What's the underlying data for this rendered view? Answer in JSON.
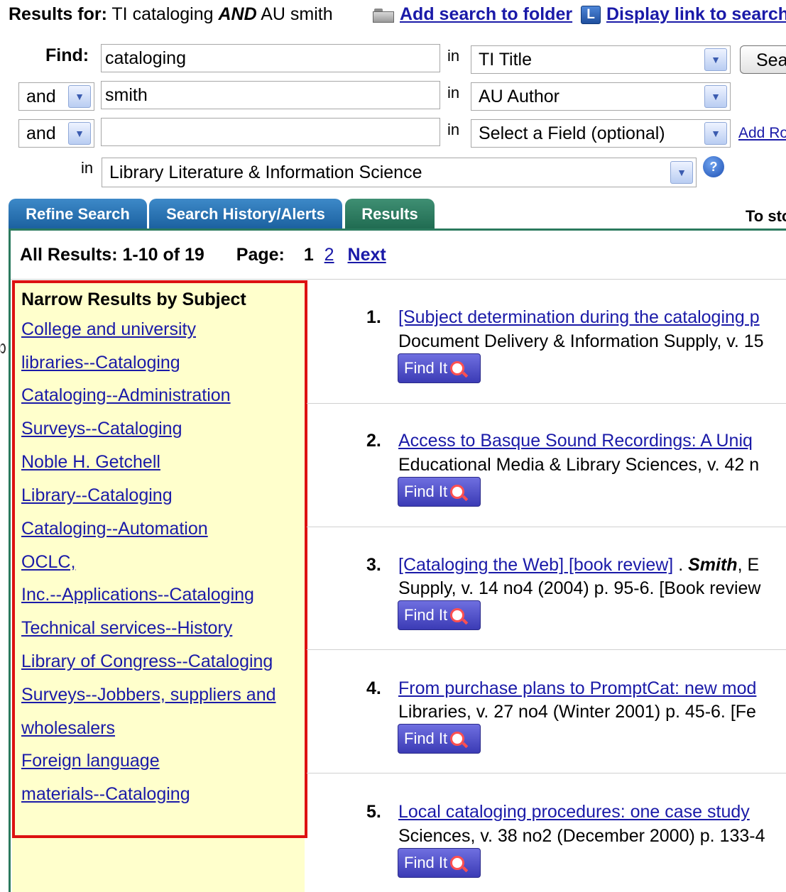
{
  "header": {
    "results_for_label": "Results for:",
    "query_part1": "TI cataloging",
    "query_operator": "AND",
    "query_part2": "AU smith",
    "add_folder_label": "Add search to folder",
    "display_link_label": "Display link to search"
  },
  "search_form": {
    "find_label": "Find:",
    "in_label": "in",
    "rows": [
      {
        "operator": "",
        "value": "cataloging",
        "field": "TI Title"
      },
      {
        "operator": "and",
        "value": "smith",
        "field": "AU Author"
      },
      {
        "operator": "and",
        "value": "",
        "field": "Select a Field (optional)"
      }
    ],
    "database": "Library Literature & Information Science",
    "search_button": "Search",
    "add_row_link": "Add Row",
    "help_icon": "?"
  },
  "tabs": [
    {
      "label": "Refine Search",
      "active": false
    },
    {
      "label": "Search History/Alerts",
      "active": false
    },
    {
      "label": "Results",
      "active": true
    }
  ],
  "tab_right_text": "To sto",
  "results_summary": {
    "label": "All Results: 1-10 of 19",
    "page_label": "Page:",
    "current_page": "1",
    "next_page": "2",
    "next_label": "Next"
  },
  "sidebar": {
    "title": "Narrow Results by Subject",
    "subjects": [
      "College and university",
      "libraries--Cataloging",
      "Cataloging--Administration",
      "Surveys--Cataloging",
      "Noble H. Getchell",
      "Library--Cataloging",
      "Cataloging--Automation",
      "OCLC,",
      "Inc.--Applications--Cataloging",
      "Technical services--History",
      "Library of Congress--Cataloging",
      "Surveys--Jobbers, suppliers and",
      "wholesalers",
      "Foreign language",
      "materials--Cataloging"
    ]
  },
  "results": [
    {
      "num": "1.",
      "title": "[Subject determination during the cataloging p",
      "source": "Document Delivery & Information Supply, v. 15"
    },
    {
      "num": "2.",
      "title": "Access to Basque Sound Recordings: A Uniq",
      "source": "Educational Media & Library Sciences, v. 42 n"
    },
    {
      "num": "3.",
      "title": "[Cataloging the Web] [book review]",
      "title_suffix": " . ",
      "author": "Smith",
      "author_suffix": ", E",
      "source": "Supply, v. 14 no4 (2004) p. 95-6. [Book review"
    },
    {
      "num": "4.",
      "title": "From purchase plans to PromptCat: new mod",
      "source": "Libraries, v. 27 no4 (Winter 2001) p. 45-6. [Fe"
    },
    {
      "num": "5.",
      "title": "Local cataloging procedures: one case study",
      "source": "Sciences, v. 38 no2 (December 2000) p. 133-4"
    }
  ],
  "find_it_label": "Find It",
  "colors": {
    "link": "#1a1aa8",
    "sidebar_bg": "#ffffcc",
    "highlight_border": "#dd1111",
    "tab_blue": "#1a5f9e",
    "tab_green": "#1f6a50",
    "find_it_bg": "#4a4ac8"
  }
}
